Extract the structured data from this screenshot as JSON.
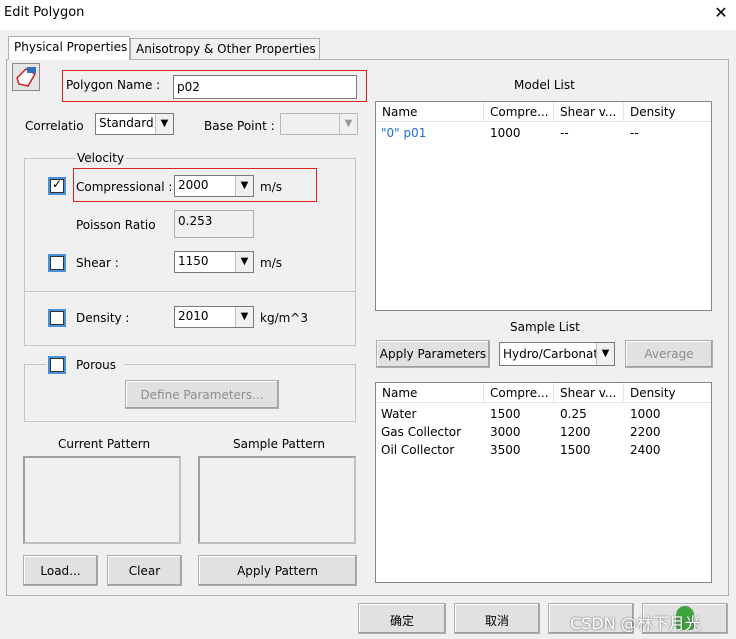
{
  "window": {
    "title": "Edit Polygon",
    "close_glyph": "✕"
  },
  "tabs": [
    {
      "label": "Physical Properties",
      "active": true
    },
    {
      "label": "Anisotropy & Other Properties",
      "active": false
    }
  ],
  "polygon_name": {
    "label": "Polygon Name :",
    "value": "p02"
  },
  "correlation": {
    "label": "Correlatio",
    "value": "Standard"
  },
  "base_point": {
    "label": "Base Point :",
    "value": ""
  },
  "velocity": {
    "caption": "Velocity",
    "compressional": {
      "label": "Compressional :",
      "value": "2000",
      "unit": "m/s",
      "checked": true
    },
    "poisson": {
      "label": "Poisson Ratio",
      "value": "0.253"
    },
    "shear": {
      "label": "Shear :",
      "value": "1150",
      "unit": "m/s",
      "checked": false
    }
  },
  "density": {
    "label": "Density :",
    "value": "2010",
    "unit": "kg/m^3",
    "checked": false
  },
  "porous": {
    "label": "Porous",
    "checked": false,
    "define_button": "Define Parameters..."
  },
  "patterns": {
    "current_label": "Current Pattern",
    "sample_label": "Sample Pattern",
    "load_button": "Load...",
    "clear_button": "Clear",
    "apply_button": "Apply Pattern"
  },
  "model_list": {
    "title": "Model List",
    "columns": [
      "Name",
      "Compre...",
      "Shear v...",
      "Density"
    ],
    "rows": [
      {
        "name": "\"0\" p01",
        "compressional": "1000",
        "shear": "--",
        "density": "--"
      }
    ]
  },
  "sample_list": {
    "title": "Sample List",
    "apply_button": "Apply Parameters",
    "category_value": "Hydro/Carbonat",
    "average_button": "Average",
    "columns": [
      "Name",
      "Compre...",
      "Shear v...",
      "Density"
    ],
    "rows": [
      {
        "name": "Water",
        "compressional": "1500",
        "shear": "0.25",
        "density": "1000"
      },
      {
        "name": "Gas Collector",
        "compressional": "3000",
        "shear": "1200",
        "density": "2200"
      },
      {
        "name": "Oil Collector",
        "compressional": "3500",
        "shear": "1500",
        "density": "2400"
      }
    ]
  },
  "footer": {
    "ok_button": "确定",
    "cancel_button": "取消",
    "apply_button": "",
    "watermark": "CSDN @林下月光"
  },
  "colors": {
    "link_blue": "#1f6fd6",
    "highlight_red": "#e02020",
    "checkbox_blue": "#4a90d9"
  }
}
